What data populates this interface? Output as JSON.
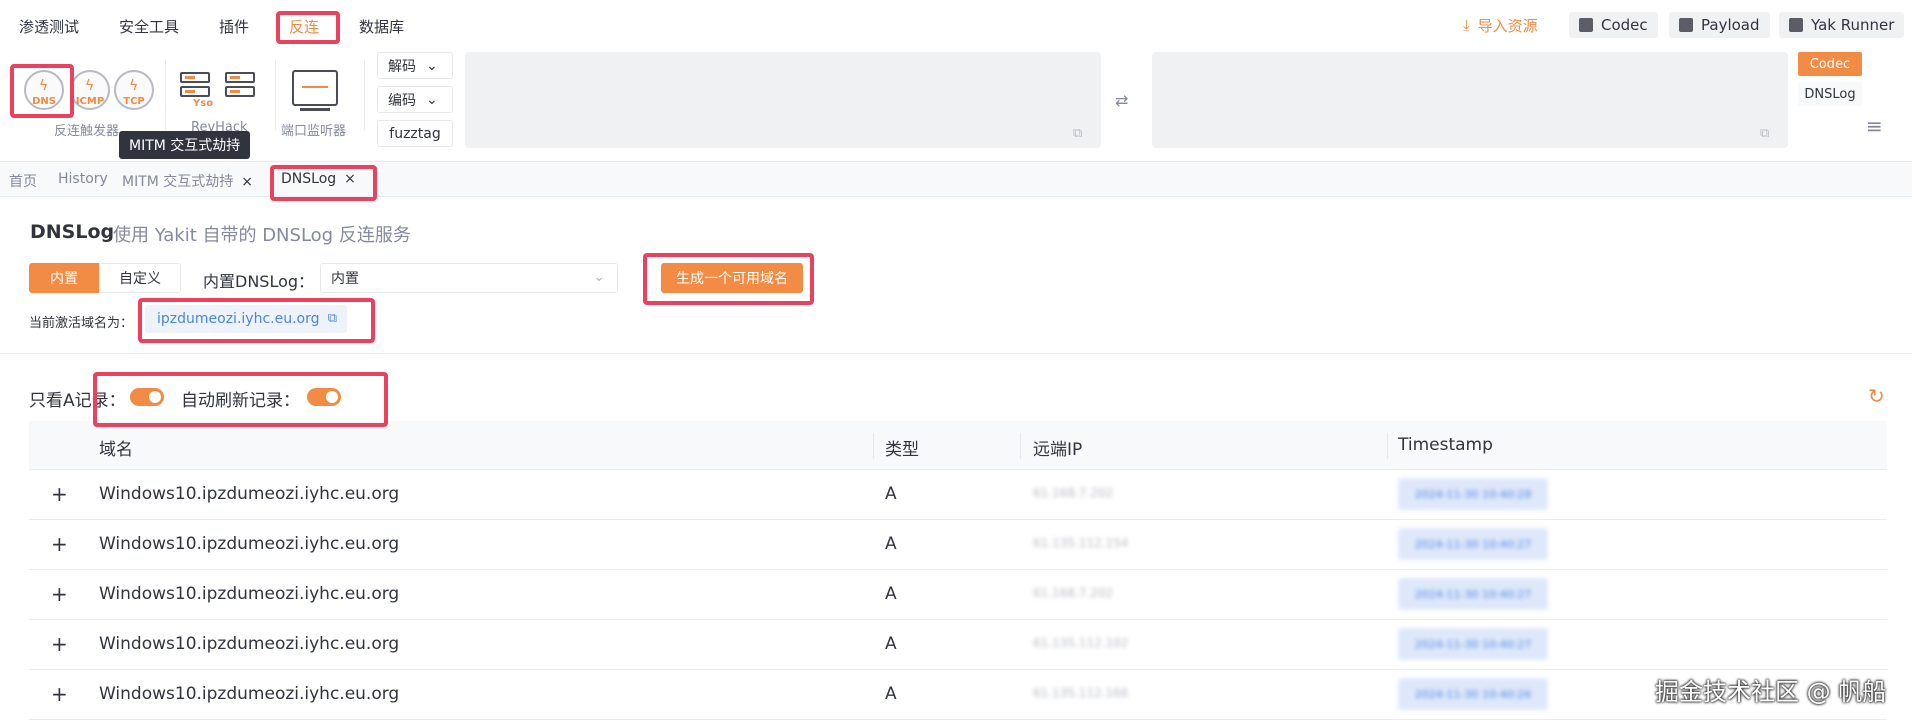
{
  "menu": {
    "items": [
      "渗透测试",
      "安全工具",
      "插件",
      "反连",
      "数据库"
    ],
    "active": "反连"
  },
  "top_right": {
    "import_label": "导入资源",
    "codec_label": "Codec",
    "payload_label": "Payload",
    "runner_label": "Yak Runner"
  },
  "toolbar": {
    "gauges": [
      "DNS",
      "ICMP",
      "TCP"
    ],
    "trigger_group_label": "反连触发器",
    "revhack_group_label": "RevHack",
    "yso_label": "Yso",
    "port_monitor_label": "端口监听器",
    "decode_label": "解码",
    "encode_label": "编码",
    "fuzztag_label": "fuzztag",
    "side_tabs": [
      "Codec",
      "DNSLog"
    ]
  },
  "tooltip": "MITM 交互式劫持",
  "tabs": {
    "home": "首页",
    "history": "History",
    "mitm": "MITM 交互式劫持",
    "dnslog": "DNSLog",
    "close": "×"
  },
  "page": {
    "title": "DNSLog",
    "subtitle": "使用 Yakit 自带的 DNSLog 反连服务",
    "mode_builtin": "内置",
    "mode_custom": "自定义",
    "select_label": "内置DNSLog：",
    "select_value": "内置",
    "generate_button": "生成一个可用域名",
    "active_domain_label": "当前激活域名为：",
    "active_domain": "ipzdumeozi.iyhc.eu.org"
  },
  "toggles": {
    "only_a_label": "只看A记录：",
    "only_a_on": true,
    "auto_refresh_label": "自动刷新记录：",
    "auto_refresh_on": true
  },
  "table": {
    "columns": [
      "域名",
      "类型",
      "远端IP",
      "Timestamp"
    ],
    "rows": [
      {
        "domain": "Windows10.ipzdumeozi.iyhc.eu.org",
        "type": "A",
        "ip": "61.168.7.202",
        "ts": "2024-11-30 10:40:28"
      },
      {
        "domain": "Windows10.ipzdumeozi.iyhc.eu.org",
        "type": "A",
        "ip": "61.135.112.154",
        "ts": "2024-11-30 10:40:27"
      },
      {
        "domain": "Windows10.ipzdumeozi.iyhc.eu.org",
        "type": "A",
        "ip": "61.168.7.202",
        "ts": "2024-11-30 10:40:27"
      },
      {
        "domain": "Windows10.ipzdumeozi.iyhc.eu.org",
        "type": "A",
        "ip": "61.135.112.102",
        "ts": "2024-11-30 10:40:27"
      },
      {
        "domain": "Windows10.ipzdumeozi.iyhc.eu.org",
        "type": "A",
        "ip": "61.135.112.166",
        "ts": "2024-11-30 10:40:26"
      }
    ]
  },
  "watermark": "掘金技术社区 @ 帆船",
  "colors": {
    "accent": "#f28b44",
    "highlight": "#e8425e",
    "link": "#4a86e0"
  }
}
